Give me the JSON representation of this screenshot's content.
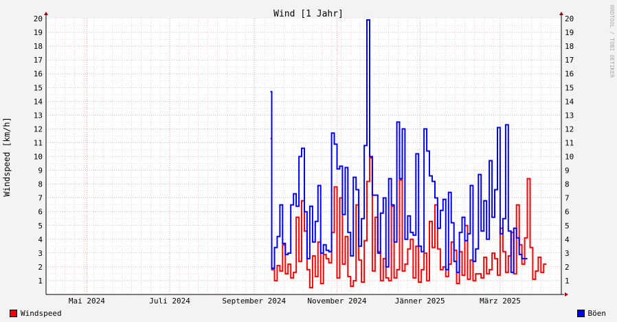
{
  "chart_data": {
    "type": "line",
    "title": "Wind [1 Jahr]",
    "ylabel": "Windspeed [km/h]",
    "watermark": "RRDTOOL / TOBI OETIKER",
    "ylim": [
      0,
      20
    ],
    "yticks": [
      1,
      2,
      3,
      4,
      5,
      6,
      7,
      8,
      9,
      10,
      11,
      12,
      13,
      14,
      15,
      16,
      17,
      18,
      19,
      20
    ],
    "xlim": [
      "2024-04-01",
      "2025-04-15"
    ],
    "xticks": [
      {
        "label": "Mai 2024",
        "date": "2024-05-01"
      },
      {
        "label": "Juli 2024",
        "date": "2024-07-01"
      },
      {
        "label": "September 2024",
        "date": "2024-09-01"
      },
      {
        "label": "November 2024",
        "date": "2024-11-01"
      },
      {
        "label": "Jänner 2025",
        "date": "2025-01-01"
      },
      {
        "label": "März 2025",
        "date": "2025-03-01"
      }
    ],
    "grid": true,
    "series": [
      {
        "name": "Windspeed",
        "color": "#ff0000",
        "points": [
          [
            "2024-09-13",
            11.3
          ],
          [
            "2024-09-14",
            1.8
          ],
          [
            "2024-09-16",
            1.0
          ],
          [
            "2024-09-18",
            2.1
          ],
          [
            "2024-09-20",
            1.7
          ],
          [
            "2024-09-22",
            3.6
          ],
          [
            "2024-09-24",
            1.5
          ],
          [
            "2024-09-26",
            2.2
          ],
          [
            "2024-09-28",
            1.2
          ],
          [
            "2024-09-30",
            1.6
          ],
          [
            "2024-10-02",
            5.6
          ],
          [
            "2024-10-04",
            2.4
          ],
          [
            "2024-10-06",
            6.8
          ],
          [
            "2024-10-08",
            4.6
          ],
          [
            "2024-10-10",
            1.8
          ],
          [
            "2024-10-12",
            0.5
          ],
          [
            "2024-10-14",
            2.8
          ],
          [
            "2024-10-16",
            1.3
          ],
          [
            "2024-10-18",
            3.8
          ],
          [
            "2024-10-20",
            0.8
          ],
          [
            "2024-10-22",
            2.9
          ],
          [
            "2024-10-24",
            2.6
          ],
          [
            "2024-10-26",
            2.3
          ],
          [
            "2024-10-28",
            4.5
          ],
          [
            "2024-10-30",
            7.8
          ],
          [
            "2024-11-01",
            1.2
          ],
          [
            "2024-11-03",
            7.0
          ],
          [
            "2024-11-05",
            2.2
          ],
          [
            "2024-11-07",
            4.2
          ],
          [
            "2024-11-09",
            1.3
          ],
          [
            "2024-11-11",
            0.6
          ],
          [
            "2024-11-13",
            1.0
          ],
          [
            "2024-11-15",
            6.5
          ],
          [
            "2024-11-17",
            2.5
          ],
          [
            "2024-11-19",
            0.9
          ],
          [
            "2024-11-21",
            3.9
          ],
          [
            "2024-11-23",
            8.2
          ],
          [
            "2024-11-25",
            9.9
          ],
          [
            "2024-11-27",
            1.7
          ],
          [
            "2024-11-29",
            5.6
          ],
          [
            "2024-12-01",
            3.1
          ],
          [
            "2024-12-03",
            1.0
          ],
          [
            "2024-12-05",
            2.6
          ],
          [
            "2024-12-07",
            1.2
          ],
          [
            "2024-12-09",
            1.0
          ],
          [
            "2024-12-11",
            6.4
          ],
          [
            "2024-12-13",
            1.2
          ],
          [
            "2024-12-15",
            1.8
          ],
          [
            "2024-12-17",
            8.3
          ],
          [
            "2024-12-19",
            1.7
          ],
          [
            "2024-12-21",
            2.2
          ],
          [
            "2024-12-23",
            3.3
          ],
          [
            "2024-12-25",
            4.0
          ],
          [
            "2024-12-27",
            1.2
          ],
          [
            "2024-12-29",
            3.5
          ],
          [
            "2024-12-31",
            0.9
          ],
          [
            "2025-01-02",
            1.8
          ],
          [
            "2025-01-04",
            3.0
          ],
          [
            "2025-01-06",
            1.0
          ],
          [
            "2025-01-08",
            5.3
          ],
          [
            "2025-01-10",
            3.4
          ],
          [
            "2025-01-12",
            6.5
          ],
          [
            "2025-01-14",
            3.3
          ],
          [
            "2025-01-16",
            1.8
          ],
          [
            "2025-01-18",
            2.0
          ],
          [
            "2025-01-20",
            1.3
          ],
          [
            "2025-01-22",
            2.2
          ],
          [
            "2025-01-24",
            3.8
          ],
          [
            "2025-01-26",
            3.2
          ],
          [
            "2025-01-28",
            0.8
          ],
          [
            "2025-01-30",
            3.1
          ],
          [
            "2025-02-01",
            1.4
          ],
          [
            "2025-02-03",
            5.0
          ],
          [
            "2025-02-05",
            1.1
          ],
          [
            "2025-02-07",
            2.5
          ],
          [
            "2025-02-09",
            1.0
          ],
          [
            "2025-02-11",
            1.5
          ],
          [
            "2025-02-13",
            1.5
          ],
          [
            "2025-02-15",
            1.2
          ],
          [
            "2025-02-17",
            2.7
          ],
          [
            "2025-02-19",
            1.5
          ],
          [
            "2025-02-21",
            1.8
          ],
          [
            "2025-02-23",
            3.0
          ],
          [
            "2025-02-25",
            2.6
          ],
          [
            "2025-02-27",
            1.4
          ],
          [
            "2025-03-01",
            4.8
          ],
          [
            "2025-03-03",
            3.1
          ],
          [
            "2025-03-05",
            1.6
          ],
          [
            "2025-03-07",
            2.8
          ],
          [
            "2025-03-09",
            4.5
          ],
          [
            "2025-03-11",
            1.5
          ],
          [
            "2025-03-13",
            6.5
          ],
          [
            "2025-03-15",
            3.6
          ],
          [
            "2025-03-17",
            2.2
          ],
          [
            "2025-03-19",
            4.1
          ],
          [
            "2025-03-21",
            8.4
          ],
          [
            "2025-03-23",
            3.4
          ],
          [
            "2025-03-25",
            1.1
          ],
          [
            "2025-03-27",
            1.7
          ],
          [
            "2025-03-29",
            2.7
          ],
          [
            "2025-03-31",
            1.6
          ],
          [
            "2025-04-02",
            2.2
          ]
        ]
      },
      {
        "name": "Böen",
        "color": "#0000ff",
        "points": [
          [
            "2024-09-13",
            14.7
          ],
          [
            "2024-09-14",
            1.9
          ],
          [
            "2024-09-16",
            3.4
          ],
          [
            "2024-09-18",
            4.2
          ],
          [
            "2024-09-20",
            6.5
          ],
          [
            "2024-09-22",
            3.7
          ],
          [
            "2024-09-24",
            2.9
          ],
          [
            "2024-09-26",
            3.0
          ],
          [
            "2024-09-28",
            6.5
          ],
          [
            "2024-09-30",
            7.3
          ],
          [
            "2024-10-02",
            6.4
          ],
          [
            "2024-10-04",
            10.0
          ],
          [
            "2024-10-06",
            10.6
          ],
          [
            "2024-10-08",
            6.0
          ],
          [
            "2024-10-10",
            2.6
          ],
          [
            "2024-10-12",
            6.4
          ],
          [
            "2024-10-14",
            3.8
          ],
          [
            "2024-10-16",
            5.3
          ],
          [
            "2024-10-18",
            7.9
          ],
          [
            "2024-10-20",
            3.0
          ],
          [
            "2024-10-22",
            3.6
          ],
          [
            "2024-10-24",
            3.2
          ],
          [
            "2024-10-26",
            3.1
          ],
          [
            "2024-10-28",
            11.7
          ],
          [
            "2024-10-30",
            10.9
          ],
          [
            "2024-11-01",
            9.1
          ],
          [
            "2024-11-03",
            9.3
          ],
          [
            "2024-11-05",
            5.8
          ],
          [
            "2024-11-07",
            9.2
          ],
          [
            "2024-11-09",
            4.5
          ],
          [
            "2024-11-11",
            2.8
          ],
          [
            "2024-11-13",
            8.5
          ],
          [
            "2024-11-15",
            7.6
          ],
          [
            "2024-11-17",
            3.5
          ],
          [
            "2024-11-19",
            5.5
          ],
          [
            "2024-11-21",
            10.8
          ],
          [
            "2024-11-23",
            19.9
          ],
          [
            "2024-11-25",
            10.0
          ],
          [
            "2024-11-27",
            7.2
          ],
          [
            "2024-11-29",
            7.2
          ],
          [
            "2024-12-01",
            3.0
          ],
          [
            "2024-12-03",
            5.9
          ],
          [
            "2024-12-05",
            7.0
          ],
          [
            "2024-12-07",
            2.0
          ],
          [
            "2024-12-09",
            8.4
          ],
          [
            "2024-12-11",
            6.5
          ],
          [
            "2024-12-13",
            3.8
          ],
          [
            "2024-12-15",
            12.5
          ],
          [
            "2024-12-17",
            8.4
          ],
          [
            "2024-12-19",
            12.0
          ],
          [
            "2024-12-21",
            4.0
          ],
          [
            "2024-12-23",
            5.7
          ],
          [
            "2024-12-25",
            4.5
          ],
          [
            "2024-12-27",
            4.3
          ],
          [
            "2024-12-29",
            10.2
          ],
          [
            "2024-12-31",
            3.5
          ],
          [
            "2025-01-02",
            3.1
          ],
          [
            "2025-01-04",
            12.0
          ],
          [
            "2025-01-06",
            10.4
          ],
          [
            "2025-01-08",
            8.6
          ],
          [
            "2025-01-10",
            8.2
          ],
          [
            "2025-01-12",
            7.0
          ],
          [
            "2025-01-14",
            4.8
          ],
          [
            "2025-01-16",
            6.1
          ],
          [
            "2025-01-18",
            6.9
          ],
          [
            "2025-01-20",
            1.8
          ],
          [
            "2025-01-22",
            7.4
          ],
          [
            "2025-01-24",
            5.2
          ],
          [
            "2025-01-26",
            2.4
          ],
          [
            "2025-01-28",
            1.6
          ],
          [
            "2025-01-30",
            4.5
          ],
          [
            "2025-02-01",
            5.6
          ],
          [
            "2025-02-03",
            3.9
          ],
          [
            "2025-02-05",
            4.4
          ],
          [
            "2025-02-07",
            7.9
          ],
          [
            "2025-02-09",
            2.4
          ],
          [
            "2025-02-11",
            3.3
          ],
          [
            "2025-02-13",
            8.7
          ],
          [
            "2025-02-15",
            4.6
          ],
          [
            "2025-02-17",
            6.8
          ],
          [
            "2025-02-19",
            4.0
          ],
          [
            "2025-02-21",
            9.7
          ],
          [
            "2025-02-23",
            5.6
          ],
          [
            "2025-02-25",
            7.6
          ],
          [
            "2025-02-27",
            12.1
          ],
          [
            "2025-03-01",
            4.4
          ],
          [
            "2025-03-03",
            5.5
          ],
          [
            "2025-03-05",
            12.3
          ],
          [
            "2025-03-07",
            4.6
          ],
          [
            "2025-03-09",
            1.6
          ],
          [
            "2025-03-11",
            4.8
          ],
          [
            "2025-03-13",
            4.1
          ],
          [
            "2025-03-15",
            2.9
          ],
          [
            "2025-03-17",
            2.6
          ],
          [
            "2025-03-19",
            2.6
          ]
        ]
      }
    ]
  }
}
